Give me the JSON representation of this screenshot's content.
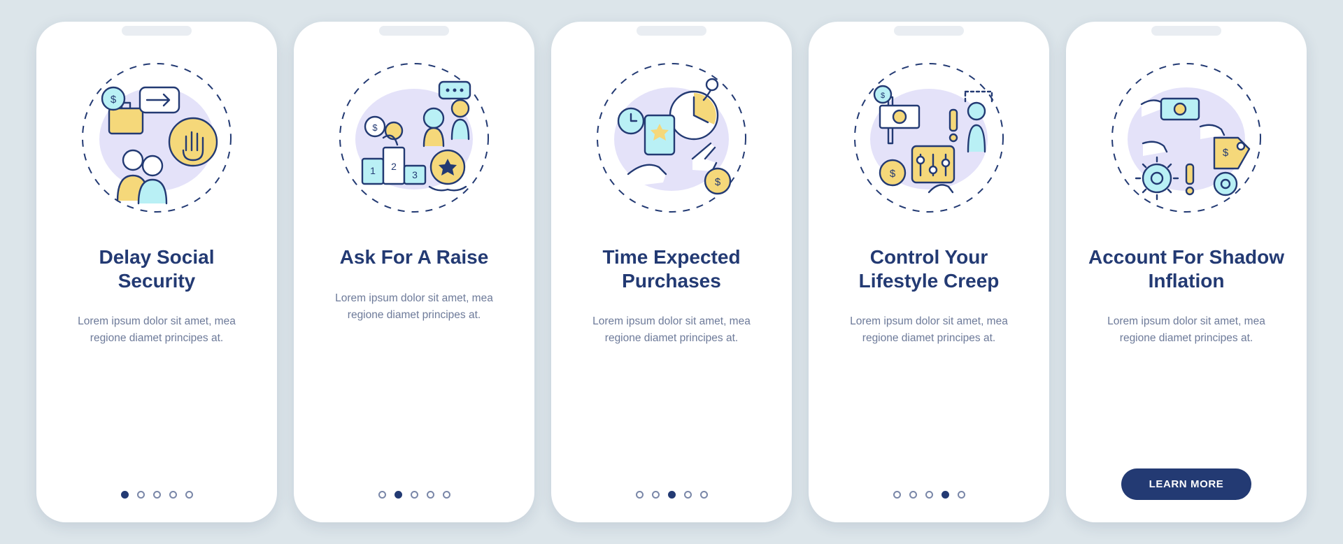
{
  "colors": {
    "navy": "#233a73",
    "yellow": "#f5d87a",
    "aqua": "#b9f0f5",
    "lilac": "#e4e2f9",
    "page_bg": "#dce5ea",
    "card_bg": "#ffffff",
    "muted_text": "#6d7a99"
  },
  "dots_total": 5,
  "cta_label": "LEARN MORE",
  "screens": [
    {
      "title": "Delay Social Security",
      "desc": "Lorem ipsum dolor sit amet, mea regione diamet principes at.",
      "active_dot": 0,
      "has_cta": false,
      "icon_name": "delay-social-security-icon"
    },
    {
      "title": "Ask For A Raise",
      "desc": "Lorem ipsum dolor sit amet, mea regione diamet principes at.",
      "active_dot": 1,
      "has_cta": false,
      "icon_name": "ask-raise-icon"
    },
    {
      "title": "Time Expected Purchases",
      "desc": "Lorem ipsum dolor sit amet, mea regione diamet principes at.",
      "active_dot": 2,
      "has_cta": false,
      "icon_name": "time-purchases-icon"
    },
    {
      "title": "Control Your Lifestyle Creep",
      "desc": "Lorem ipsum dolor sit amet, mea regione diamet principes at.",
      "active_dot": 3,
      "has_cta": false,
      "icon_name": "lifestyle-creep-icon"
    },
    {
      "title": "Account For Shadow Inflation",
      "desc": "Lorem ipsum dolor sit amet, mea regione diamet principes at.",
      "active_dot": 4,
      "has_cta": true,
      "icon_name": "shadow-inflation-icon"
    }
  ]
}
